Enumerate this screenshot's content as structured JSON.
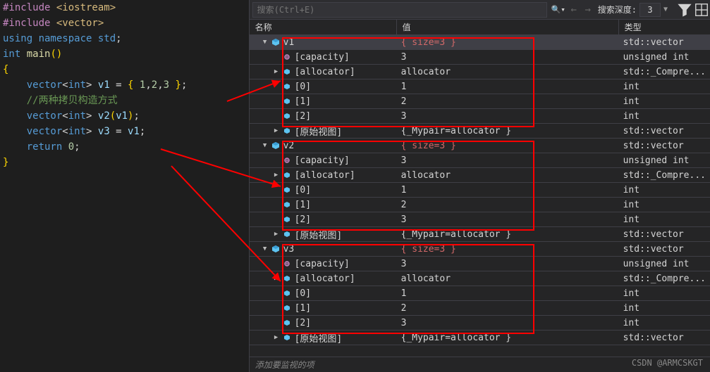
{
  "code": {
    "lines": [
      {
        "pre": "",
        "parts": [
          {
            "c": "inc",
            "t": "#include "
          },
          {
            "c": "str",
            "t": "<iostream>"
          }
        ]
      },
      {
        "pre": "",
        "parts": [
          {
            "c": "inc",
            "t": "#include "
          },
          {
            "c": "str",
            "t": "<vector>"
          }
        ]
      },
      {
        "pre": "",
        "parts": [
          {
            "c": "kw",
            "t": "using namespace "
          },
          {
            "c": "type",
            "t": "std"
          },
          {
            "c": "",
            "t": ";"
          }
        ]
      },
      {
        "pre": "",
        "parts": [
          {
            "c": "",
            "t": ""
          }
        ]
      },
      {
        "pre": "",
        "parts": [
          {
            "c": "kw",
            "t": "int "
          },
          {
            "c": "func",
            "t": "main"
          },
          {
            "c": "paren",
            "t": "()"
          }
        ]
      },
      {
        "pre": "",
        "parts": [
          {
            "c": "paren",
            "t": "{"
          }
        ]
      },
      {
        "pre": "    ",
        "parts": [
          {
            "c": "type",
            "t": "vector"
          },
          {
            "c": "",
            "t": "<"
          },
          {
            "c": "kw",
            "t": "int"
          },
          {
            "c": "",
            "t": "> "
          },
          {
            "c": "var",
            "t": "v1"
          },
          {
            "c": "",
            "t": " = "
          },
          {
            "c": "paren",
            "t": "{"
          },
          {
            "c": "",
            "t": " "
          },
          {
            "c": "num",
            "t": "1"
          },
          {
            "c": "",
            "t": ","
          },
          {
            "c": "num",
            "t": "2"
          },
          {
            "c": "",
            "t": ","
          },
          {
            "c": "num",
            "t": "3"
          },
          {
            "c": "",
            "t": " "
          },
          {
            "c": "paren",
            "t": "}"
          },
          {
            "c": "",
            "t": ";"
          }
        ]
      },
      {
        "pre": "",
        "parts": [
          {
            "c": "",
            "t": ""
          }
        ]
      },
      {
        "pre": "    ",
        "parts": [
          {
            "c": "comment",
            "t": "//两种拷贝构造方式"
          }
        ]
      },
      {
        "pre": "    ",
        "parts": [
          {
            "c": "type",
            "t": "vector"
          },
          {
            "c": "",
            "t": "<"
          },
          {
            "c": "kw",
            "t": "int"
          },
          {
            "c": "",
            "t": "> "
          },
          {
            "c": "var",
            "t": "v2"
          },
          {
            "c": "paren",
            "t": "("
          },
          {
            "c": "var",
            "t": "v1"
          },
          {
            "c": "paren",
            "t": ")"
          },
          {
            "c": "",
            "t": ";"
          }
        ]
      },
      {
        "pre": "    ",
        "parts": [
          {
            "c": "type",
            "t": "vector"
          },
          {
            "c": "",
            "t": "<"
          },
          {
            "c": "kw",
            "t": "int"
          },
          {
            "c": "",
            "t": "> "
          },
          {
            "c": "var",
            "t": "v3"
          },
          {
            "c": "",
            "t": " = "
          },
          {
            "c": "var",
            "t": "v1"
          },
          {
            "c": "",
            "t": ";"
          }
        ]
      },
      {
        "pre": "",
        "parts": [
          {
            "c": "",
            "t": ""
          }
        ]
      },
      {
        "pre": "    ",
        "parts": [
          {
            "c": "kw",
            "t": "return "
          },
          {
            "c": "num",
            "t": "0"
          },
          {
            "c": "",
            "t": ";"
          }
        ]
      },
      {
        "pre": "",
        "parts": [
          {
            "c": "paren",
            "t": "}"
          }
        ]
      }
    ]
  },
  "search": {
    "placeholder": "搜索(Ctrl+E)",
    "depth_label": "搜索深度:",
    "depth": "3"
  },
  "headers": {
    "name": "名称",
    "value": "值",
    "type": "类型"
  },
  "rows": [
    {
      "indent": 1,
      "exp": "down",
      "icon": "obj",
      "name": "v1",
      "val": "{ size=3 }",
      "sizeVal": true,
      "type": "std::vector<in...",
      "selected": true
    },
    {
      "indent": 2,
      "exp": "",
      "icon": "raw",
      "name": "[capacity]",
      "val": "3",
      "type": "unsigned int"
    },
    {
      "indent": 2,
      "exp": "right",
      "icon": "field",
      "name": "[allocator]",
      "val": "allocator",
      "type": "std::_Compre..."
    },
    {
      "indent": 2,
      "exp": "",
      "icon": "field",
      "name": "[0]",
      "val": "1",
      "type": "int"
    },
    {
      "indent": 2,
      "exp": "",
      "icon": "field",
      "name": "[1]",
      "val": "2",
      "type": "int"
    },
    {
      "indent": 2,
      "exp": "",
      "icon": "field",
      "name": "[2]",
      "val": "3",
      "type": "int"
    },
    {
      "indent": 2,
      "exp": "right",
      "icon": "field",
      "name": "[原始视图]",
      "val": "{_Mypair=allocator }",
      "type": "std::vector<in..."
    },
    {
      "indent": 1,
      "exp": "down",
      "icon": "obj",
      "name": "v2",
      "val": "{ size=3 }",
      "sizeVal": true,
      "type": "std::vector<in..."
    },
    {
      "indent": 2,
      "exp": "",
      "icon": "raw",
      "name": "[capacity]",
      "val": "3",
      "type": "unsigned int"
    },
    {
      "indent": 2,
      "exp": "right",
      "icon": "field",
      "name": "[allocator]",
      "val": "allocator",
      "type": "std::_Compre..."
    },
    {
      "indent": 2,
      "exp": "",
      "icon": "field",
      "name": "[0]",
      "val": "1",
      "type": "int"
    },
    {
      "indent": 2,
      "exp": "",
      "icon": "field",
      "name": "[1]",
      "val": "2",
      "type": "int"
    },
    {
      "indent": 2,
      "exp": "",
      "icon": "field",
      "name": "[2]",
      "val": "3",
      "type": "int"
    },
    {
      "indent": 2,
      "exp": "right",
      "icon": "field",
      "name": "[原始视图]",
      "val": "{_Mypair=allocator }",
      "type": "std::vector<in..."
    },
    {
      "indent": 1,
      "exp": "down",
      "icon": "obj",
      "name": "v3",
      "val": "{ size=3 }",
      "sizeVal": true,
      "type": "std::vector<in..."
    },
    {
      "indent": 2,
      "exp": "",
      "icon": "raw",
      "name": "[capacity]",
      "val": "3",
      "type": "unsigned int"
    },
    {
      "indent": 2,
      "exp": "right",
      "icon": "field",
      "name": "[allocator]",
      "val": "allocator",
      "type": "std::_Compre..."
    },
    {
      "indent": 2,
      "exp": "",
      "icon": "field",
      "name": "[0]",
      "val": "1",
      "type": "int"
    },
    {
      "indent": 2,
      "exp": "",
      "icon": "field",
      "name": "[1]",
      "val": "2",
      "type": "int"
    },
    {
      "indent": 2,
      "exp": "",
      "icon": "field",
      "name": "[2]",
      "val": "3",
      "type": "int"
    },
    {
      "indent": 2,
      "exp": "right",
      "icon": "field",
      "name": "[原始视图]",
      "val": "{_Mypair=allocator }",
      "type": "std::vector<in..."
    }
  ],
  "add_watch": "添加要监视的项",
  "watermark": "CSDN @ARMCSKGT"
}
